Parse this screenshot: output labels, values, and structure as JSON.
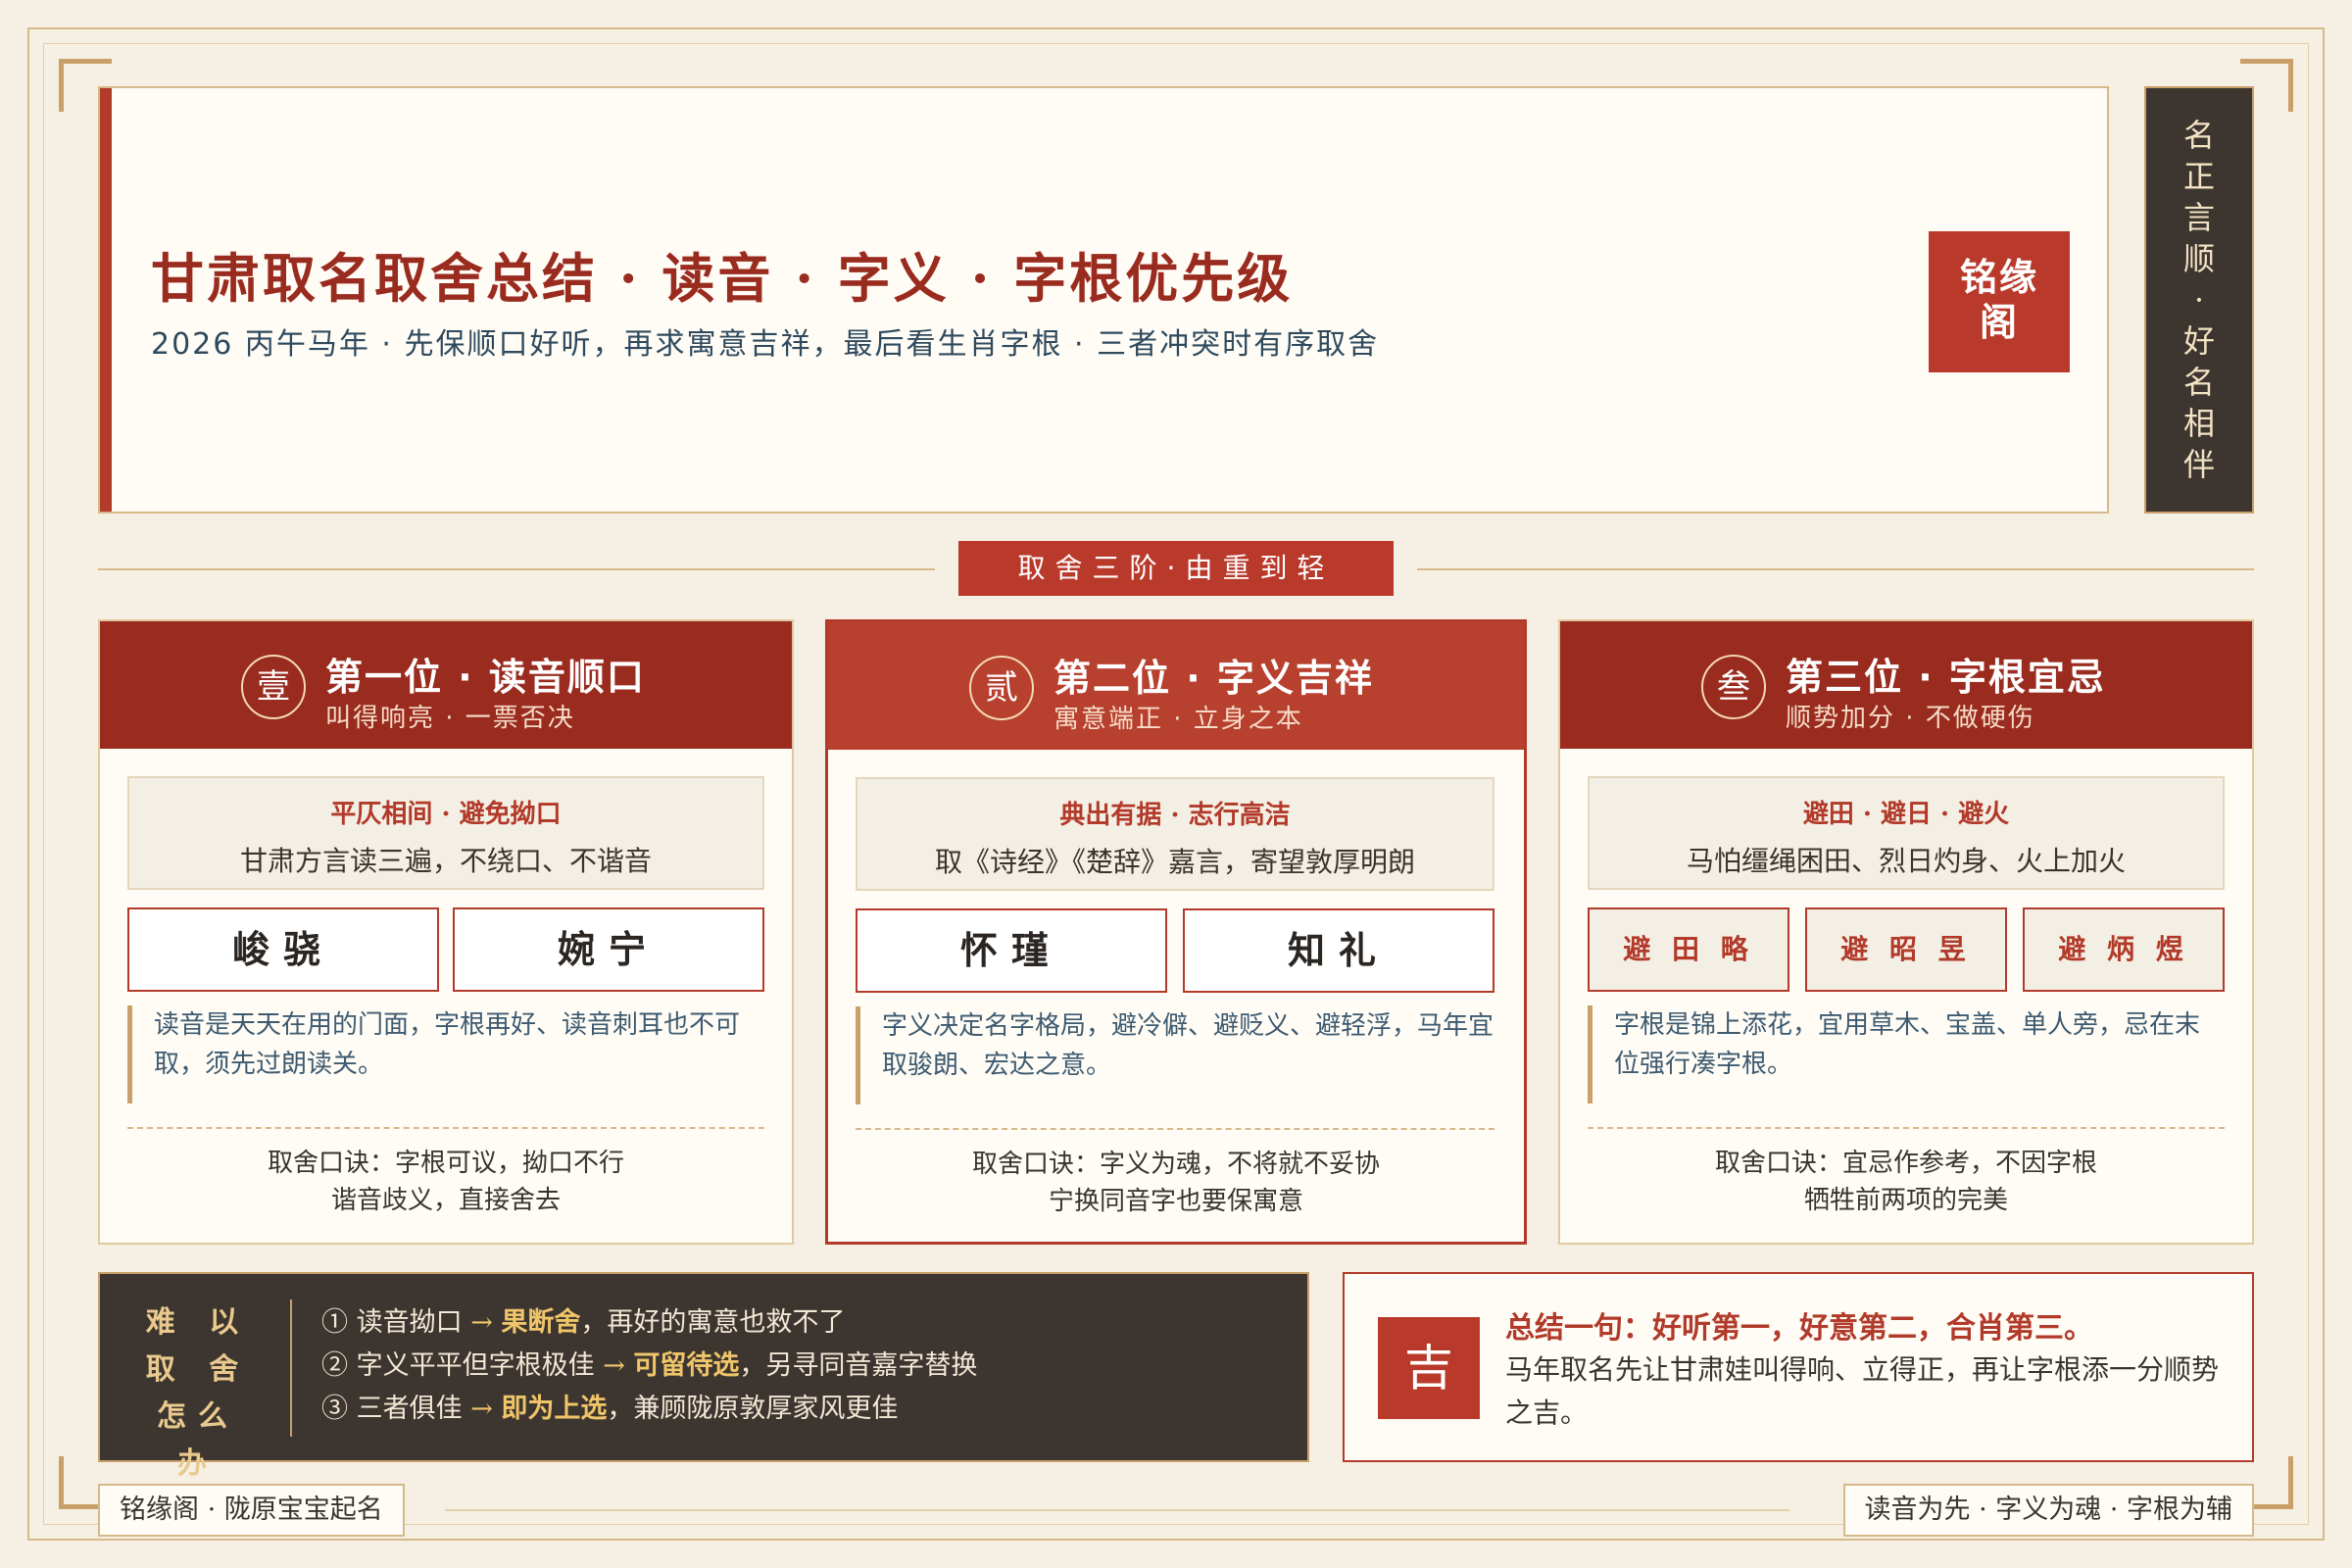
{
  "header": {
    "title": "甘肃取名取舍总结 · 读音 · 字义 · 字根优先级",
    "subtitle": "2026 丙午马年 · 先保顺口好听，再求寓意吉祥，最后看生肖字根 · 三者冲突时有序取舍",
    "seal": "铭缘阁"
  },
  "side_banner": [
    "名",
    "正",
    "言",
    "顺",
    "·",
    "好",
    "名",
    "相",
    "伴"
  ],
  "divider": "取舍三阶·由重到轻",
  "cards": [
    {
      "badge": "壹",
      "title": "第一位 · 读音顺口",
      "sub": "叫得响亮 · 一票否决",
      "tip_h": "平仄相间 · 避免拗口",
      "tip_b": "甘肃方言读三遍，不绕口、不谐音",
      "names": [
        "峻骁",
        "婉宁"
      ],
      "note": "读音是天天在用的门面，字根再好、读音刺耳也不可取，须先过朗读关。",
      "motto_1": "取舍口诀：字根可议，拗口不行",
      "motto_2": "谐音歧义，直接舍去"
    },
    {
      "badge": "贰",
      "title": "第二位 · 字义吉祥",
      "sub": "寓意端正 · 立身之本",
      "tip_h": "典出有据 · 志行高洁",
      "tip_b": "取《诗经》《楚辞》嘉言，寄望敦厚明朗",
      "names": [
        "怀瑾",
        "知礼"
      ],
      "note": "字义决定名字格局，避冷僻、避贬义、避轻浮，马年宜取骏朗、宏达之意。",
      "motto_1": "取舍口诀：字义为魂，不将就不妥协",
      "motto_2": "宁换同音字也要保寓意"
    },
    {
      "badge": "叁",
      "title": "第三位 · 字根宜忌",
      "sub": "顺势加分 · 不做硬伤",
      "tip_h": "避田 · 避日 · 避火",
      "tip_b": "马怕缰绳困田、烈日灼身、火上加火",
      "names": [
        "避 田 略",
        "避 昭 昱",
        "避 炳 煜"
      ],
      "note": "字根是锦上添花，宜用草木、宝盖、单人旁，忌在末位强行凑字根。",
      "motto_1": "取舍口诀：宜忌作参考，不因字根",
      "motto_2": "牺牲前两项的完美"
    }
  ],
  "dilemma": {
    "label": [
      "难 以",
      "取 舍",
      "怎么办"
    ],
    "lines": [
      {
        "pre": "① 读音拗口",
        "key": "果断舍",
        "post": "，再好的寓意也救不了"
      },
      {
        "pre": "② 字义平平但字根极佳",
        "key": "可留待选",
        "post": "，另寻同音嘉字替换"
      },
      {
        "pre": "③ 三者俱佳",
        "key": "即为上选",
        "post": "，兼顾陇原敦厚家风更佳"
      }
    ],
    "arrow": "→"
  },
  "summary": {
    "badge": "吉",
    "headline": "总结一句：好听第一，好意第二，合肖第三。",
    "body": "马年取名先让甘肃娃叫得响、立得正，再让字根添一分顺势之吉。"
  },
  "footer": {
    "left": "铭缘阁 · 陇原宝宝起名",
    "right": "读音为先 · 字义为魂 · 字根为辅"
  },
  "colors": {
    "accent_red": "#b23a2a",
    "dark_red": "#9a2b1f",
    "gold": "#c9a06a",
    "dark_panel": "#3d3630",
    "paper": "#f6f0e4"
  }
}
